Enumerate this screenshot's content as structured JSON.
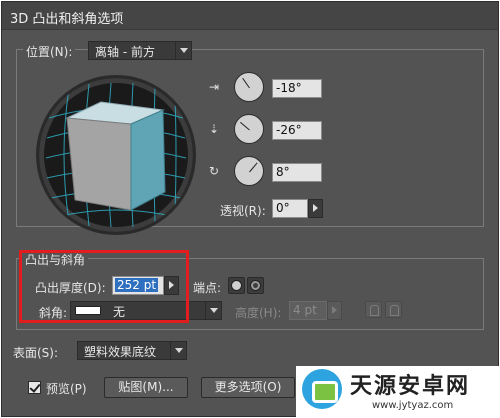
{
  "window": {
    "title": "3D 凸出和斜角选项"
  },
  "position": {
    "label": "位置(N):",
    "preset": "离轴 - 前方",
    "x_rotation": "-18°",
    "y_rotation": "-26°",
    "z_rotation": "8°",
    "perspective_label": "透视(R):",
    "perspective": "0°",
    "icons": [
      "x-axis-rotate-icon",
      "y-axis-rotate-icon",
      "z-axis-rotate-icon"
    ]
  },
  "extrude": {
    "group_title": "凸出与斜角",
    "depth_label": "凸出厚度(D):",
    "depth": "252 pt",
    "cap_label": "端点:",
    "bevel_label": "斜角:",
    "bevel": "无",
    "height_label": "高度(H):",
    "height": "4 pt"
  },
  "surface": {
    "label": "表面(S):",
    "value": "塑料效果底纹"
  },
  "footer": {
    "preview_label": "预览(P)",
    "preview_checked": true,
    "map_art_button": "贴图(M)...",
    "more_options_button": "更多选项(O)"
  },
  "watermark": {
    "title": "天源安卓网",
    "url": "www.jytyaz.com"
  },
  "colors": {
    "cube_front": "#5fa5b5",
    "cube_top": "#c9dee3",
    "cube_side": "#a4a4a4",
    "grid": "#2fa9bf",
    "highlight": "#e01e1e"
  }
}
